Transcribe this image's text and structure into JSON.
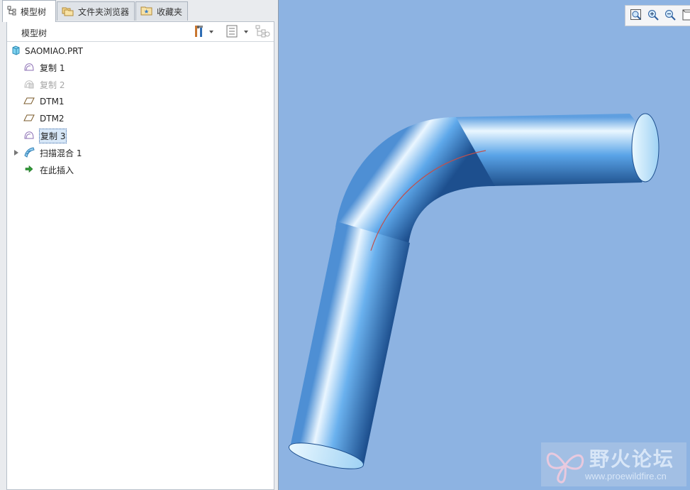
{
  "tabs": [
    {
      "label": "模型树",
      "icon": "tree-icon"
    },
    {
      "label": "文件夹浏览器",
      "icon": "folders-icon"
    },
    {
      "label": "收藏夹",
      "icon": "favorites-folder-icon"
    }
  ],
  "model_tree": {
    "title": "模型树",
    "root": {
      "label": "SAOMIAO.PRT",
      "icon": "part-icon"
    },
    "items": [
      {
        "label": "复制 1",
        "icon": "surface-copy-icon",
        "state": "normal"
      },
      {
        "label": "复制 2",
        "icon": "surface-copy-icon",
        "state": "suppressed"
      },
      {
        "label": "DTM1",
        "icon": "datum-plane-icon",
        "state": "normal"
      },
      {
        "label": "DTM2",
        "icon": "datum-plane-icon",
        "state": "normal"
      },
      {
        "label": "复制 3",
        "icon": "surface-copy-icon",
        "state": "selected"
      },
      {
        "label": "扫描混合 1",
        "icon": "swept-blend-icon",
        "state": "normal",
        "expandable": true
      },
      {
        "label": "在此插入",
        "icon": "insert-here-arrow-icon",
        "state": "normal"
      }
    ],
    "header_buttons": [
      "tree-settings-icon",
      "show-columns-icon",
      "filter-icon"
    ]
  },
  "view_toolbar": [
    "refit-icon",
    "zoom-in-icon",
    "zoom-out-icon",
    "repaint-icon"
  ],
  "watermark": {
    "title": "野火论坛",
    "url": "www.proewildfire.cn"
  },
  "colors": {
    "viewport_bg": "#8db3e2",
    "pipe": "#5aa8ec",
    "curve": "#c0504d",
    "selection": "#d7e7f7"
  }
}
